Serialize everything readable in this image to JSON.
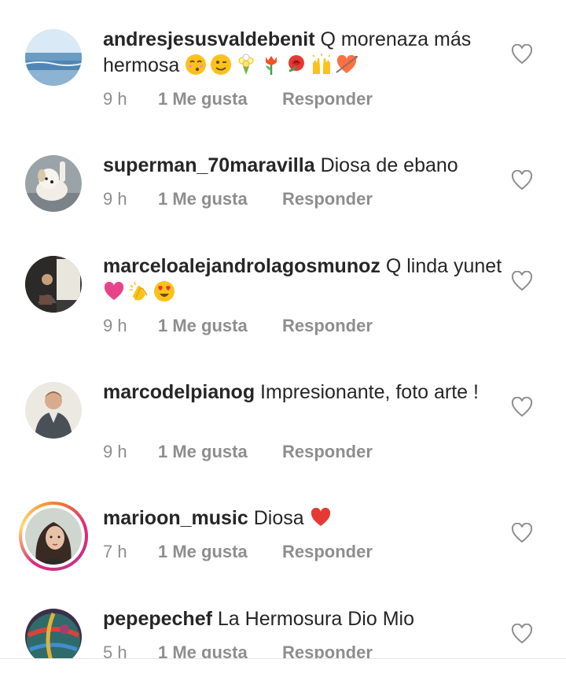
{
  "comments": [
    {
      "username": "andresjesusvaldebenit",
      "text": "Q morenaza más hermosa",
      "emojis": [
        "kissing-face-emoji",
        "winking-face-emoji",
        "bouquet-emoji",
        "tulip-emoji",
        "rose-emoji",
        "raising-hands-emoji",
        "heart-arrow-emoji"
      ],
      "time": "9 h",
      "likes": "1 Me gusta",
      "reply": "Responder"
    },
    {
      "username": "superman_70maravilla",
      "text": "Diosa de ebano",
      "emojis": [],
      "time": "9 h",
      "likes": "1 Me gusta",
      "reply": "Responder"
    },
    {
      "username": "marceloalejandrolagosmunoz",
      "text": "Q linda yunet",
      "emojis": [
        "pink-heart-emoji",
        "clapping-hands-emoji",
        "heart-eyes-emoji"
      ],
      "time": "9 h",
      "likes": "1 Me gusta",
      "reply": "Responder"
    },
    {
      "username": "marcodelpianog",
      "text": "Impresionante, foto arte !",
      "emojis": [],
      "time": "9 h",
      "likes": "1 Me gusta",
      "reply": "Responder"
    },
    {
      "username": "marioon_music",
      "text": "Diosa",
      "emojis": [
        "red-heart-emoji"
      ],
      "time": "7 h",
      "likes": "1 Me gusta",
      "reply": "Responder"
    },
    {
      "username": "pepepechef",
      "text": "La Hermosura Dio Mio",
      "emojis": [],
      "time": "5 h",
      "likes": "1 Me gusta",
      "reply": "Responder"
    }
  ],
  "colors": {
    "text": "#262626",
    "meta": "#8e8e8e",
    "heart_outline": "#8e8e8e",
    "red_heart": "#ed4956",
    "pink_heart": "#e8438a"
  }
}
